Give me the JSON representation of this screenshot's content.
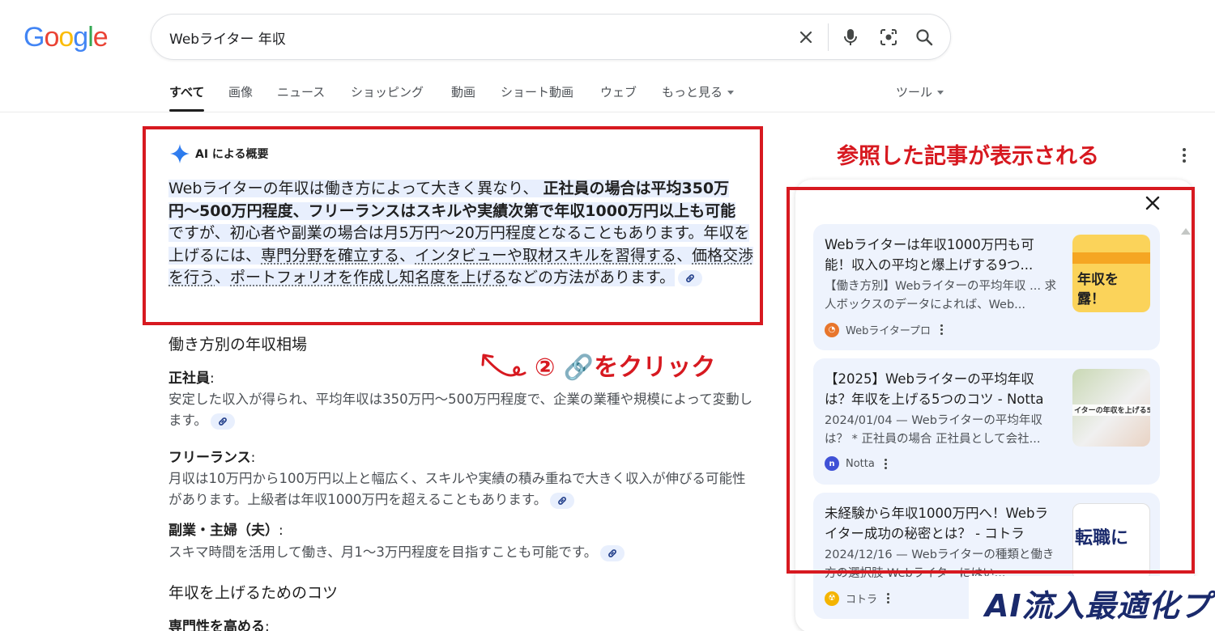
{
  "search": {
    "query": "Webライター 年収"
  },
  "logo": {
    "letters": [
      "G",
      "o",
      "o",
      "g",
      "l",
      "e"
    ],
    "colors": [
      "#4285F4",
      "#EA4335",
      "#FBBC05",
      "#4285F4",
      "#34A853",
      "#EA4335"
    ]
  },
  "tabs": [
    "すべて",
    "画像",
    "ニュース",
    "ショッピング",
    "動画",
    "ショート動画",
    "ウェブ",
    "もっと見る",
    "ツール"
  ],
  "ai_overview": {
    "label": "AI による概要",
    "p_part1": "Webライターの年収は働き方によって大きく異なり、",
    "p_bold1": "正社員の場合は平均350万円〜500万円程度、フリーランスはスキルや実績次第で年収1000万円以上も可能",
    "p_part2": "ですが、初心者や副業の場合は月5万円〜20万円程度となることもあります。年収を上げるには、",
    "p_link1": "専門分野を確立する",
    "p_sep1": "、",
    "p_link2": "インタビューや取材スキルを習得する",
    "p_sep2": "、",
    "p_link3": "価格交渉を行う",
    "p_sep3": "、",
    "p_link4": "ポートフォリオを作成し知名度を上げる",
    "p_part3": "などの方法があります。"
  },
  "sections": {
    "heading1": "働き方別の年収相場",
    "fulltime_label": "正社員",
    "fulltime_text": "安定した収入が得られ、平均年収は350万円〜500万円程度で、企業の業種や規模によって変動します。",
    "freelance_label": "フリーランス",
    "freelance_text": "月収は10万円から100万円以上と幅広く、スキルや実績の積み重ねで大きく収入が伸びる可能性があります。上級者は年収1000万円を超えることもあります。",
    "side_label": "副業・主婦（夫）",
    "side_text": "スキマ時間を活用して働き、月1〜3万円程度を目指すことも可能です。",
    "heading2": "年収を上げるためのコツ",
    "tip1_label": "専門性を高める"
  },
  "colon": ":",
  "annotations": {
    "click_instruction": "② 🔗をクリック",
    "panel_caption": "参照した記事が表示される"
  },
  "sources": [
    {
      "title": "Webライターは年収1000万円も可能！収入の平均と爆上げする9つ...",
      "snippet": "【働き方別】Webライターの平均年収 ... 求人ボックスのデータによれば、Web...",
      "site": "Webライタープロ",
      "thumb_text": "年収を 露！",
      "thumb_color": "#fbd35a",
      "favicon_color": "#e8762c"
    },
    {
      "title": "【2025】Webライターの平均年収は？年収を上げる5つのコツ - Notta",
      "snippet": "2024/01/04 — Webライターの平均年収は？ * 正社員の場合 正社員として会社...",
      "site": "Notta",
      "thumb_text": "イターの年収を上げる5",
      "thumb_color": "#d9e6c7",
      "favicon_color": "#3f51d6"
    },
    {
      "title": "未経験から年収1000万円へ！Webライター成功の秘密とは？ - コトラ",
      "snippet": "2024/12/16 — Webライターの種類と働き方の選択肢 Webライターにはい...",
      "site": "コトラ",
      "thumb_text": "転職に",
      "thumb_color": "#ffffff",
      "favicon_color": "#f4b400"
    }
  ],
  "watermark": {
    "brand": "AI流入最適化プロ"
  }
}
